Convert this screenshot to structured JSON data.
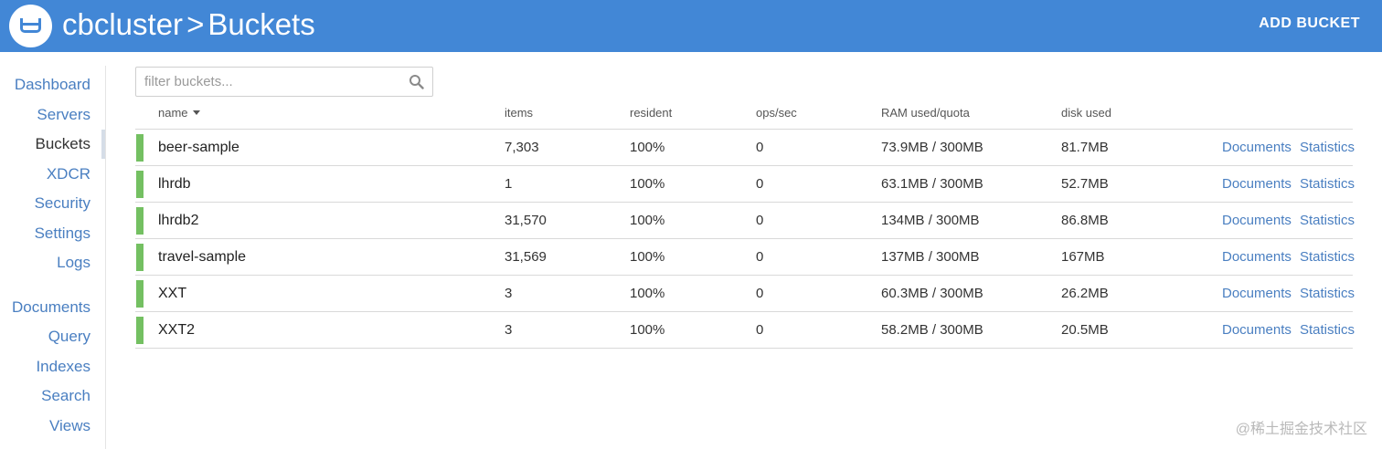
{
  "header": {
    "cluster": "cbcluster",
    "separator": ">",
    "page": "Buckets",
    "add_bucket_label": "ADD BUCKET",
    "accent": "#4287d6"
  },
  "sidebar": {
    "items": [
      {
        "label": "Dashboard"
      },
      {
        "label": "Servers"
      },
      {
        "label": "Buckets",
        "active": true
      },
      {
        "label": "XDCR"
      },
      {
        "label": "Security"
      },
      {
        "label": "Settings"
      },
      {
        "label": "Logs"
      },
      {
        "label": "Documents"
      },
      {
        "label": "Query"
      },
      {
        "label": "Indexes"
      },
      {
        "label": "Search"
      },
      {
        "label": "Views"
      }
    ]
  },
  "filter": {
    "placeholder": "filter buckets...",
    "icon": "search-icon"
  },
  "table": {
    "columns": {
      "name": "name",
      "items": "items",
      "resident": "resident",
      "ops": "ops/sec",
      "ram": "RAM used/quota",
      "disk": "disk used"
    },
    "status_color": "#74c062",
    "rows": [
      {
        "name": "beer-sample",
        "items": "7,303",
        "resident": "100%",
        "ops": "0",
        "ram": "73.9MB / 300MB",
        "disk": "81.7MB",
        "docs": "Documents",
        "stats": "Statistics"
      },
      {
        "name": "lhrdb",
        "items": "1",
        "resident": "100%",
        "ops": "0",
        "ram": "63.1MB / 300MB",
        "disk": "52.7MB",
        "docs": "Documents",
        "stats": "Statistics"
      },
      {
        "name": "lhrdb2",
        "items": "31,570",
        "resident": "100%",
        "ops": "0",
        "ram": "134MB / 300MB",
        "disk": "86.8MB",
        "docs": "Documents",
        "stats": "Statistics"
      },
      {
        "name": "travel-sample",
        "items": "31,569",
        "resident": "100%",
        "ops": "0",
        "ram": "137MB / 300MB",
        "disk": "167MB",
        "docs": "Documents",
        "stats": "Statistics"
      },
      {
        "name": "XXT",
        "items": "3",
        "resident": "100%",
        "ops": "0",
        "ram": "60.3MB / 300MB",
        "disk": "26.2MB",
        "docs": "Documents",
        "stats": "Statistics"
      },
      {
        "name": "XXT2",
        "items": "3",
        "resident": "100%",
        "ops": "0",
        "ram": "58.2MB / 300MB",
        "disk": "20.5MB",
        "docs": "Documents",
        "stats": "Statistics"
      }
    ]
  },
  "watermark": "@稀土掘金技术社区"
}
